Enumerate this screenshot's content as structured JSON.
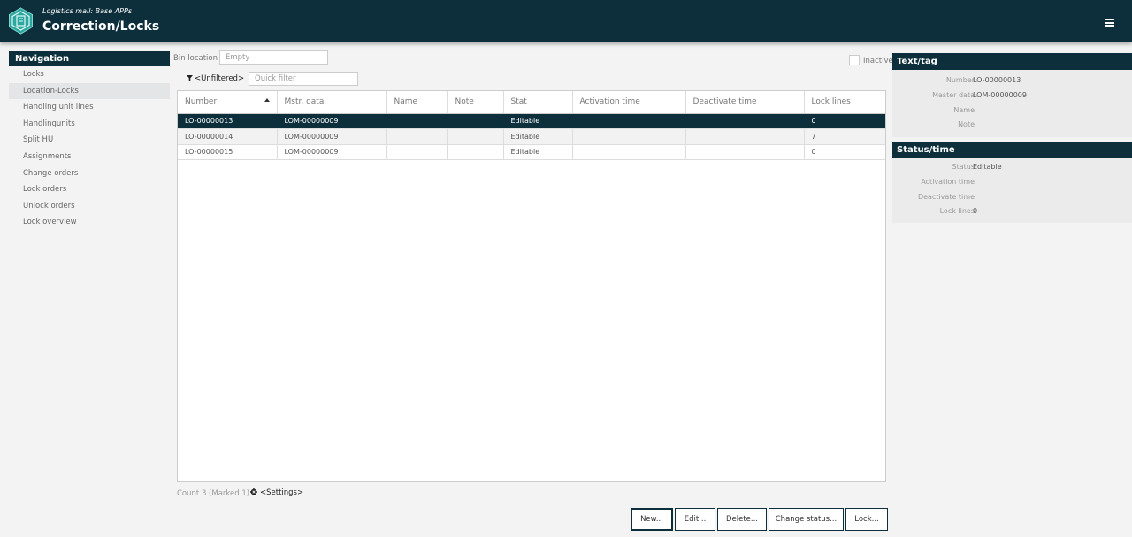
{
  "header": {
    "subtitle": "Logistics mall: Base APPs",
    "title": "Correction/Locks"
  },
  "navigation": {
    "title": "Navigation",
    "items": [
      {
        "label": "Locks",
        "active": false
      },
      {
        "label": "Location-Locks",
        "active": true
      },
      {
        "label": "Handling unit lines",
        "active": false
      },
      {
        "label": "Handlingunits",
        "active": false
      },
      {
        "label": "Split HU",
        "active": false
      },
      {
        "label": "Assignments",
        "active": false
      },
      {
        "label": "Change orders",
        "active": false
      },
      {
        "label": "Lock orders",
        "active": false
      },
      {
        "label": "Unlock orders",
        "active": false
      },
      {
        "label": "Lock overview",
        "active": false
      }
    ]
  },
  "filters": {
    "bin_location_label": "Bin location",
    "bin_location_placeholder": "Empty",
    "filter_link": "<Unfiltered>",
    "quick_filter_placeholder": "Quick filter",
    "inactive_label": "Inactive"
  },
  "table": {
    "columns": [
      "Number",
      "Mstr. data",
      "Name",
      "Note",
      "Stat",
      "Activation time",
      "Deactivate time",
      "Lock lines"
    ],
    "rows": [
      {
        "cells": [
          "LO-00000013",
          "LOM-00000009",
          "",
          "",
          "Editable",
          "",
          "",
          "0"
        ],
        "selected": true
      },
      {
        "cells": [
          "LO-00000014",
          "LOM-00000009",
          "",
          "",
          "Editable",
          "",
          "",
          "7"
        ],
        "selected": false
      },
      {
        "cells": [
          "LO-00000015",
          "LOM-00000009",
          "",
          "",
          "Editable",
          "",
          "",
          "0"
        ],
        "selected": false
      }
    ],
    "sort_column": "Number",
    "sort_direction": "ascending"
  },
  "footer": {
    "count_text": "Count 3 (Marked 1)",
    "settings_link": "<Settings>"
  },
  "buttons": {
    "new": "New...",
    "edit": "Edit...",
    "delete": "Delete...",
    "change_status": "Change status...",
    "lock": "Lock..."
  },
  "text_tag_panel": {
    "title": "Text/tag",
    "fields": [
      {
        "key": "Number",
        "value": "LO-00000013"
      },
      {
        "key": "Master data",
        "value": "LOM-00000009"
      },
      {
        "key": "Name",
        "value": ""
      },
      {
        "key": "Note",
        "value": ""
      }
    ]
  },
  "status_time_panel": {
    "title": "Status/time",
    "fields": [
      {
        "key": "Status",
        "value": "Editable"
      },
      {
        "key": "Activation time",
        "value": ""
      },
      {
        "key": "Deactivate time",
        "value": ""
      },
      {
        "key": "Lock lines",
        "value": "0"
      }
    ]
  },
  "colors": {
    "primary": "#0d2f3c",
    "background": "#f3f3f3",
    "active_nav": "#e3e5e6"
  },
  "icons": [
    "app-logo-icon",
    "menu-icon",
    "filter-icon",
    "gear-icon",
    "sort-ascending-icon"
  ]
}
